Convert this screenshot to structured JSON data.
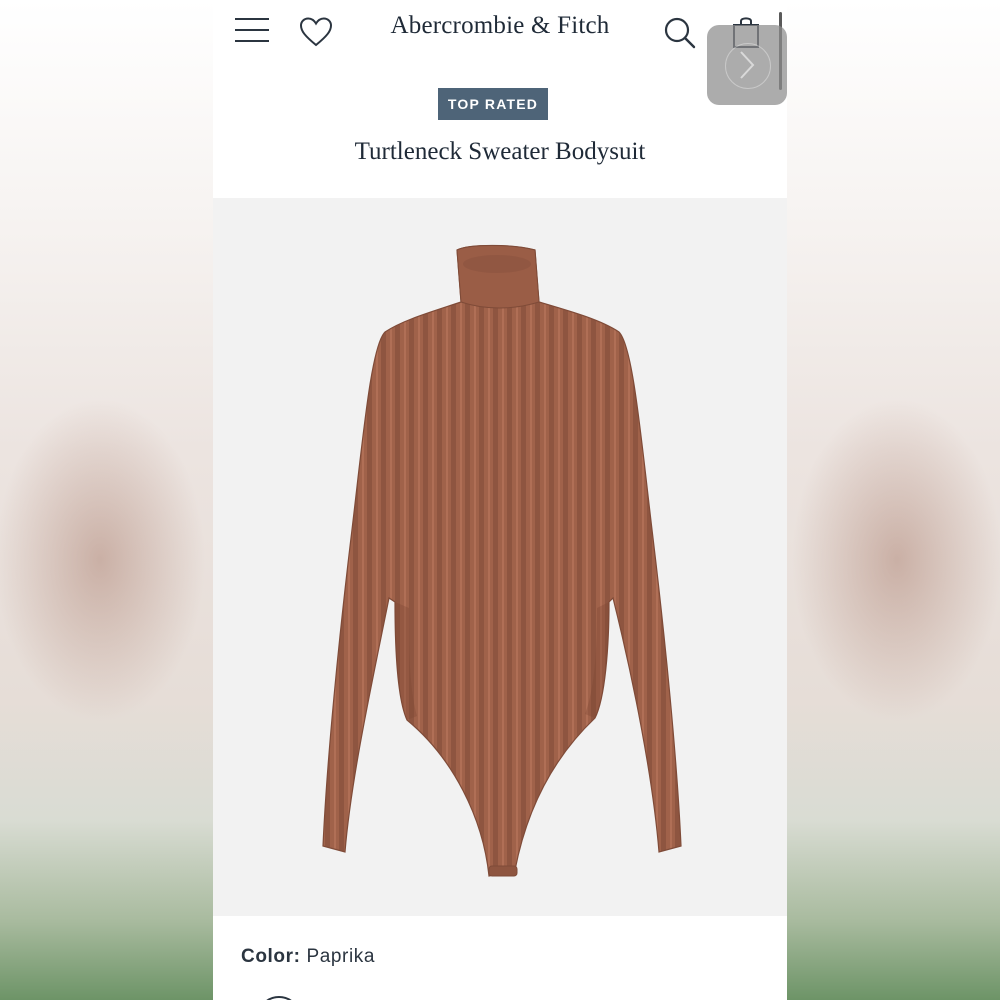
{
  "brand": {
    "name": "Abercrombie & Fitch"
  },
  "header": {
    "menu_icon": "hamburger-menu-icon",
    "wishlist_icon": "heart-icon",
    "search_icon": "search-icon",
    "bag_icon": "shopping-bag-icon"
  },
  "overlay": {
    "icon": "chevron-right-icon"
  },
  "badge": {
    "label": "TOP RATED"
  },
  "product": {
    "title": "Turtleneck Sweater Bodysuit",
    "image": "ribbed-turtleneck-bodysuit-image",
    "color_label": "Color:",
    "color_value": "Paprika"
  },
  "colors": {
    "badge_bg": "#4e6478",
    "text": "#1f2a37",
    "garment": "#a0624a",
    "image_bg": "#f2f2f2"
  }
}
